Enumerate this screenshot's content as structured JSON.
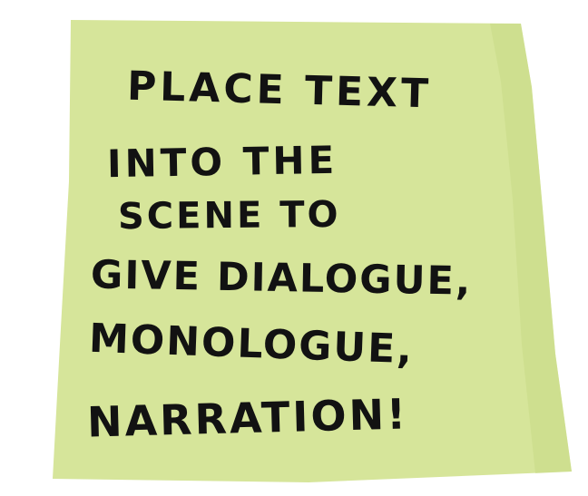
{
  "note": {
    "color": "#d6e59a",
    "ink_color": "#121212",
    "lines": [
      "PLACE TEXT",
      "INTO THE",
      "SCENE TO",
      "GIVE DIALOGUE,",
      "MONOLOGUE,",
      "NARRATION!"
    ]
  }
}
